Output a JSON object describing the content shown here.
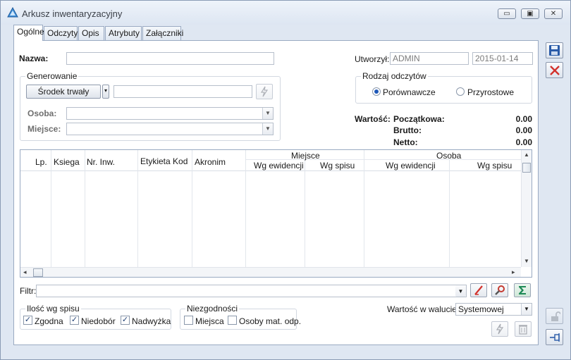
{
  "window": {
    "title": "Arkusz inwentaryzacyjny",
    "buttons": {
      "minimize": "▭",
      "maximize": "▣",
      "close": "✕"
    }
  },
  "tabs": [
    {
      "label": "Ogólne",
      "active": true
    },
    {
      "label": "Odczyty"
    },
    {
      "label": "Opis"
    },
    {
      "label": "Atrybuty"
    },
    {
      "label": "Załączniki"
    }
  ],
  "form": {
    "nazwa_label": "Nazwa:",
    "nazwa_value": "",
    "utworzyl_label": "Utworzył:",
    "utworzyl_user": "ADMIN",
    "utworzyl_date": "2015-01-14",
    "generowanie": {
      "title": "Generowanie",
      "type_button": "Środek trwały",
      "type_value": "",
      "osoba_label": "Osoba:",
      "miejsce_label": "Miejsce:"
    },
    "rodzaj": {
      "title": "Rodzaj odczytów",
      "options": [
        "Porównawcze",
        "Przyrostowe"
      ],
      "selected": "Porównawcze"
    },
    "wartosc": {
      "label": "Wartość:",
      "rows": [
        {
          "label": "Początkowa:",
          "value": "0.00"
        },
        {
          "label": "Brutto:",
          "value": "0.00"
        },
        {
          "label": "Netto:",
          "value": "0.00"
        }
      ]
    }
  },
  "grid": {
    "columns": [
      "Lp.",
      "Ksiega",
      "Nr. Inw.",
      "Etykieta Kod",
      "Akronim"
    ],
    "group_miejsce": "Miejsce",
    "group_osoba": "Osoba",
    "sub_wg_ewidencji": "Wg ewidencji",
    "sub_wg_spisu": "Wg spisu",
    "rows": []
  },
  "filter": {
    "label": "Filtr:",
    "value": ""
  },
  "ilosc": {
    "title": "Ilość wg spisu",
    "options": [
      {
        "label": "Zgodna",
        "checked": true
      },
      {
        "label": "Niedobór",
        "checked": true
      },
      {
        "label": "Nadwyżka",
        "checked": true
      }
    ]
  },
  "niezgodnosci": {
    "title": "Niezgodności",
    "options": [
      {
        "label": "Miejsca",
        "checked": false
      },
      {
        "label": "Osoby mat. odp.",
        "checked": false
      }
    ]
  },
  "waluta": {
    "label": "Wartość w walucie:",
    "value": "Systemowej"
  },
  "colors": {
    "accent": "#1e58b8",
    "save": "#2a5ba8",
    "delete": "#d2322d",
    "sum": "#1e8a56"
  }
}
